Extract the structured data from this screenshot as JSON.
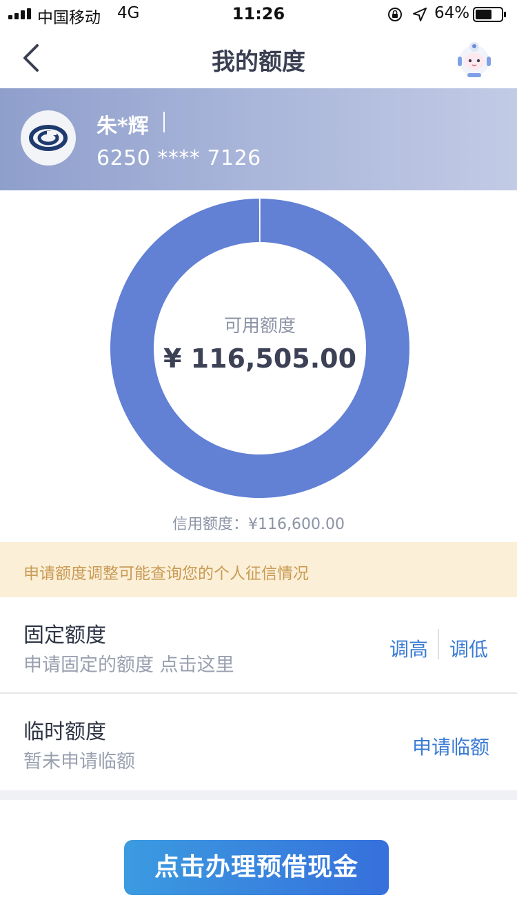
{
  "status_bar": {
    "carrier": "中国移动",
    "network": "4G",
    "time": "11:26",
    "battery_percent": "64%",
    "battery_level": 0.64
  },
  "nav": {
    "title": "我的额度",
    "back_icon": "chevron-left-icon",
    "assistant_icon": "robot-assistant-icon"
  },
  "card": {
    "name": "朱*辉",
    "number": "6250 **** 7126",
    "bank_icon": "bank-logo-icon"
  },
  "quota": {
    "available_label": "可用额度",
    "available_value": "¥ 116,505.00",
    "credit_limit_text": "信用额度：¥116,600.00"
  },
  "chart_data": {
    "type": "pie",
    "values": [
      116505,
      95
    ],
    "colors": [
      "#6280d4",
      "#ffffff"
    ]
  },
  "notice": {
    "text": "申请额度调整可能查询您的个人征信情况"
  },
  "fixed_quota": {
    "title": "固定额度",
    "subtitle": "申请固定的额度 点击这里",
    "raise_label": "调高",
    "lower_label": "调低"
  },
  "temp_quota": {
    "title": "临时额度",
    "subtitle": "暂未申请临额",
    "apply_label": "申请临额"
  },
  "cta": {
    "label": "点击办理预借现金"
  },
  "colors": {
    "accent_blue": "#3a7bd5",
    "donut_blue": "#6280d4",
    "notice_bg": "#fbefd7",
    "notice_text": "#c99b55"
  }
}
